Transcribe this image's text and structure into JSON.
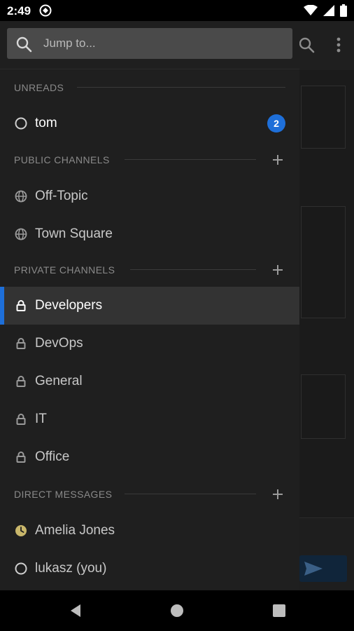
{
  "status_bar": {
    "time": "2:49"
  },
  "drawer": {
    "search": {
      "placeholder": "Jump to..."
    },
    "sections": {
      "unreads": {
        "title": "UNREADS",
        "items": [
          {
            "label": "tom",
            "badge": "2"
          }
        ]
      },
      "public_channels": {
        "title": "PUBLIC CHANNELS",
        "items": [
          {
            "label": "Off-Topic"
          },
          {
            "label": "Town Square"
          }
        ]
      },
      "private_channels": {
        "title": "PRIVATE CHANNELS",
        "items": [
          {
            "label": "Developers",
            "active": true
          },
          {
            "label": "DevOps"
          },
          {
            "label": "General"
          },
          {
            "label": "IT"
          },
          {
            "label": "Office"
          }
        ]
      },
      "direct_messages": {
        "title": "DIRECT MESSAGES",
        "items": [
          {
            "label": "Amelia Jones",
            "status": "away"
          },
          {
            "label": "lukasz (you)",
            "status": "offline"
          }
        ]
      }
    }
  },
  "colors": {
    "accent": "#1e6fd9",
    "away": "#c9b76b",
    "drawer_bg": "#1f1f1f"
  },
  "icons": {
    "search": "search-icon",
    "public": "globe-icon",
    "private": "lock-icon",
    "offline": "circle-outline-icon",
    "away": "clock-icon",
    "add": "plus-icon"
  }
}
